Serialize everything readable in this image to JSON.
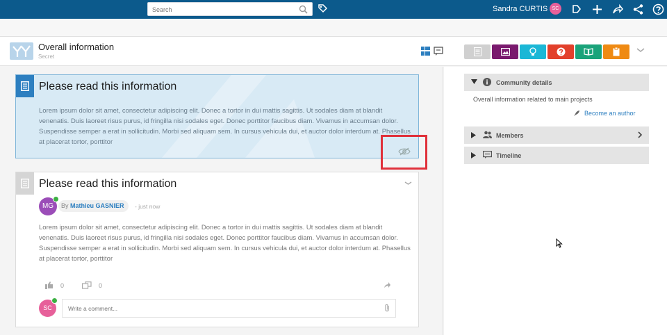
{
  "topbar": {
    "search_placeholder": "Search",
    "username": "Sandra CURTIS",
    "avatar_initials": "SC"
  },
  "space": {
    "title": "Overall information",
    "subtitle": "Secret"
  },
  "apps": [
    {
      "name": "news-app",
      "color": "#d0d0d0"
    },
    {
      "name": "gallery-app",
      "color": "#7a1a6e"
    },
    {
      "name": "ideas-app",
      "color": "#1bb7d6"
    },
    {
      "name": "questions-app",
      "color": "#e2402b"
    },
    {
      "name": "wiki-app",
      "color": "#1aa37a"
    },
    {
      "name": "tasks-app",
      "color": "#ef8a13"
    }
  ],
  "post1": {
    "title": "Please read this information",
    "body": "Lorem ipsum dolor sit amet, consectetur adipiscing elit. Donec a tortor in dui mattis sagittis. Ut sodales diam at blandit venenatis. Duis laoreet risus purus, id fringilla nisi sodales eget. Donec porttitor faucibus diam. Vivamus in accumsan dolor. Suspendisse semper a erat in sollicitudin. Morbi sed aliquam sem. In cursus vehicula dui, et auctor dolor interdum at. Phasellus at placerat tortor, porttitor"
  },
  "post2": {
    "title": "Please read this information",
    "author_initials": "MG",
    "by_label": "By",
    "author_name": "Mathieu GASNIER",
    "time": "- just now",
    "body": "Lorem ipsum dolor sit amet, consectetur adipiscing elit. Donec a tortor in dui mattis sagittis. Ut sodales diam at blandit venenatis. Duis laoreet risus purus, id fringilla nisi sodales eget. Donec porttitor faucibus diam. Vivamus in accumsan dolor. Suspendisse semper a erat in sollicitudin. Morbi sed aliquam sem. In cursus vehicula dui, et auctor dolor interdum at. Phasellus at placerat tortor, porttitor",
    "likes_count": "0",
    "reposts_count": "0",
    "commenter_initials": "SC",
    "comment_placeholder": "Write a comment..."
  },
  "sidebar": {
    "community_label": "Community details",
    "community_desc": "Overall information related to main projects",
    "become_author": "Become an author",
    "members_label": "Members",
    "timeline_label": "Timeline"
  },
  "colors": {
    "topbar": "#0c5a8c",
    "accent": "#2d7fc0",
    "highlight_box": "#e0303a"
  }
}
